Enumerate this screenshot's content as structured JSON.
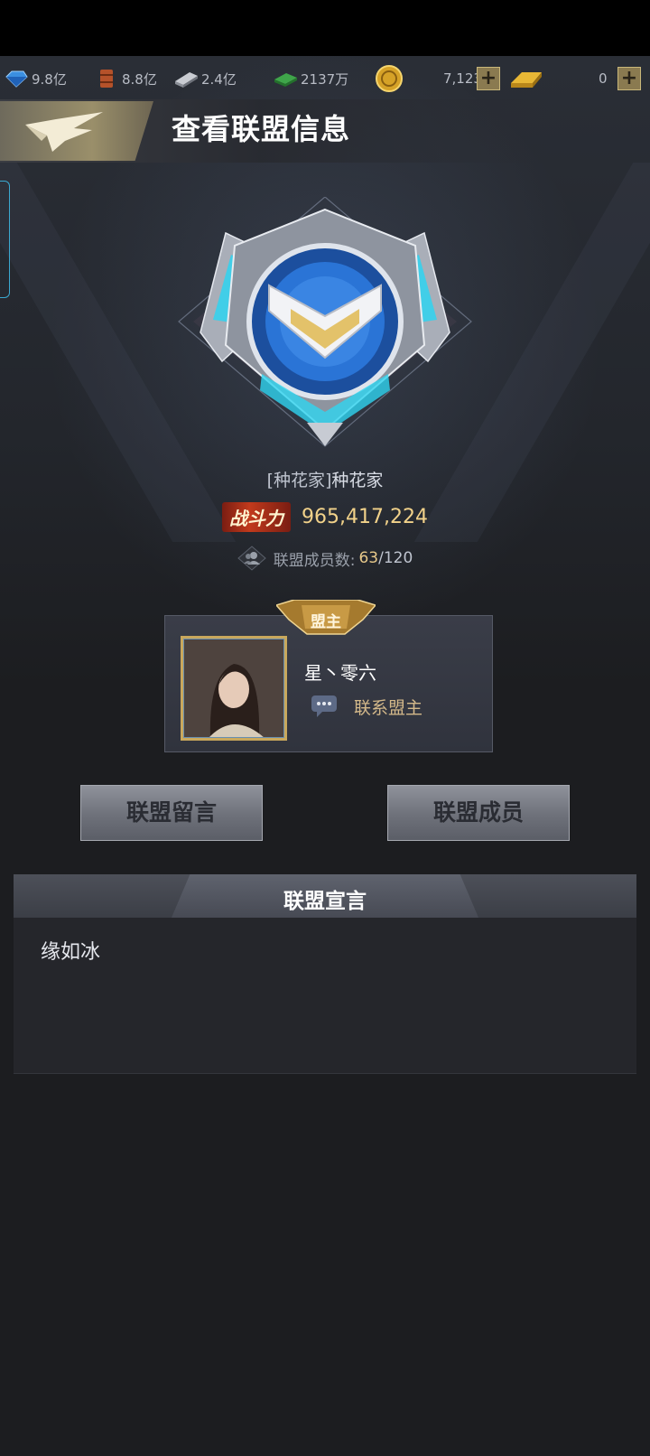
{
  "resources": [
    {
      "icon": "crystal-icon",
      "value": "9.8亿"
    },
    {
      "icon": "oil-barrel-icon",
      "value": "8.8亿"
    },
    {
      "icon": "steel-bar-icon",
      "value": "2.4亿"
    },
    {
      "icon": "cash-stack-icon",
      "value": "2137万"
    },
    {
      "icon": "gold-coin-icon",
      "value": "7,123"
    },
    {
      "icon": "gold-bar-icon",
      "value": "0"
    }
  ],
  "header": {
    "title": "查看联盟信息"
  },
  "alliance": {
    "tag": "[种花家]",
    "name": "种花家",
    "power_label": "战斗力",
    "power_value": "965,417,224",
    "members_label": "联盟成员数:",
    "members_count": "63",
    "members_total": "/120"
  },
  "leader": {
    "badge": "盟主",
    "name": "星丶零六",
    "contact_label": "联系盟主"
  },
  "buttons": {
    "messages": "联盟留言",
    "members": "联盟成员"
  },
  "declaration": {
    "title": "联盟宣言",
    "text": "缘如冰"
  },
  "colors": {
    "accent_gold": "#f2d28a",
    "emblem_blue": "#2a74d6",
    "emblem_cyan": "#2fd4f0"
  }
}
